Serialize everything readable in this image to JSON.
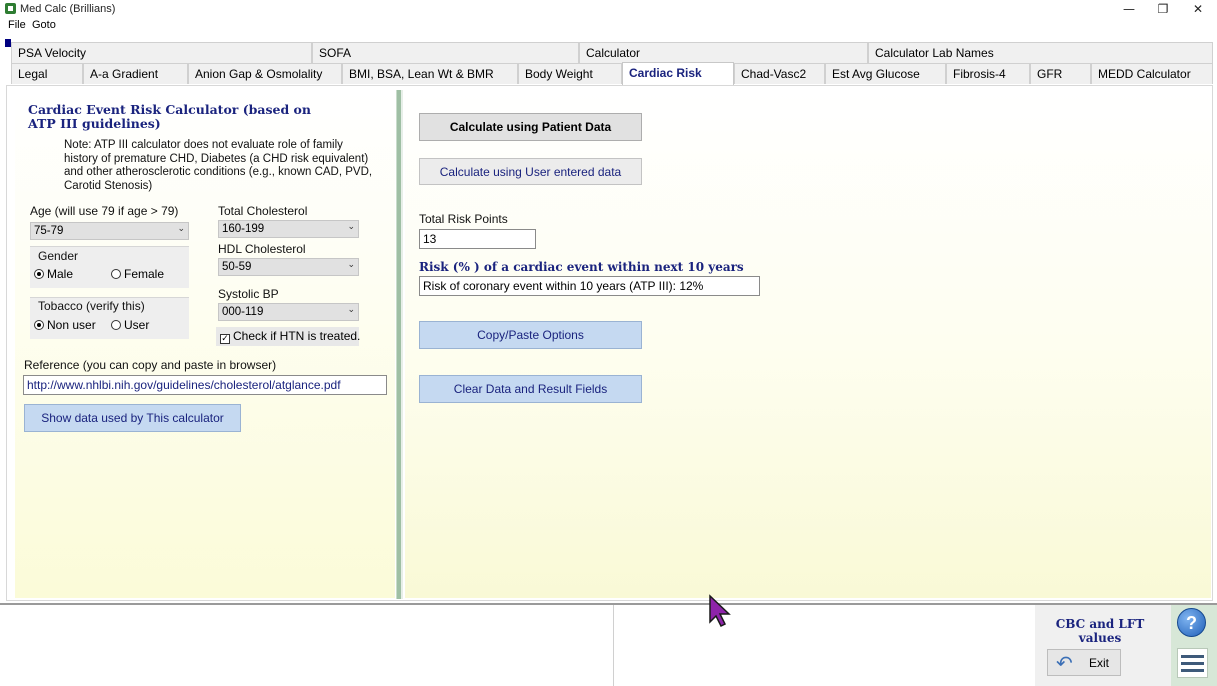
{
  "window": {
    "title": "Med Calc (Brillians)",
    "controls": {
      "minimize": "—",
      "restore": "❐",
      "close": "✕"
    }
  },
  "menu": {
    "items": [
      "File",
      "Goto"
    ]
  },
  "tabs": {
    "row1": [
      "PSA Velocity",
      "SOFA",
      "Calculator",
      "Calculator Lab Names"
    ],
    "row2": [
      "Legal",
      "A-a Gradient",
      "Anion Gap & Osmolality",
      "BMI, BSA, Lean Wt & BMR",
      "Body Weight",
      "Cardiac Risk",
      "Chad-Vasc2",
      "Est Avg Glucose",
      "Fibrosis-4",
      "GFR",
      "MEDD Calculator"
    ],
    "active": "Cardiac Risk"
  },
  "left": {
    "heading": "Cardiac Event Risk Calculator (based on ATP III guidelines)",
    "note": "Note: ATP III calculator does not evaluate role of family history of premature CHD, Diabetes (a CHD risk equivalent) and other atherosclerotic conditions (e.g., known CAD, PVD, Carotid Stenosis)",
    "age_label": "Age (will use 79 if  age > 79)",
    "age_value": "75-79",
    "gender_label": "Gender",
    "gender_male": "Male",
    "gender_female": "Female",
    "gender_selected": "Male",
    "tobacco_label": "Tobacco (verify this)",
    "tobacco_non_user": "Non user",
    "tobacco_user": "User",
    "tobacco_selected": "Non user",
    "total_chol_label": "Total Cholesterol",
    "total_chol_value": "160-199",
    "hdl_label": "HDL Cholesterol",
    "hdl_value": "50-59",
    "sbp_label": "Systolic BP",
    "sbp_value": "000-119",
    "htn_label": "Check if HTN is treated.",
    "htn_checked": true,
    "reference_label": "Reference (you can copy and paste in browser)",
    "reference_url": "http://www.nhlbi.nih.gov/guidelines/cholesterol/atglance.pdf",
    "show_data_button": "Show data used by This calculator"
  },
  "right": {
    "calc_patient_button": "Calculate using Patient Data",
    "calc_user_button": "Calculate using User entered data",
    "total_points_label": "Total Risk Points",
    "total_points_value": "13",
    "risk_label": "Risk (% ) of a cardiac event within next 10 years",
    "risk_value": "Risk of coronary event within 10 years (ATP III): 12%",
    "copy_paste_button": "Copy/Paste Options",
    "clear_button": "Clear Data and Result Fields"
  },
  "bottom": {
    "cbc_label": "CBC and LFT values",
    "exit_label": "Exit",
    "help_glyph": "?"
  },
  "colors": {
    "accent_text": "#1a237e",
    "blue_button": "#c5d9f1",
    "splitter": "#9fbfa4",
    "cursor": "#8e24aa"
  }
}
